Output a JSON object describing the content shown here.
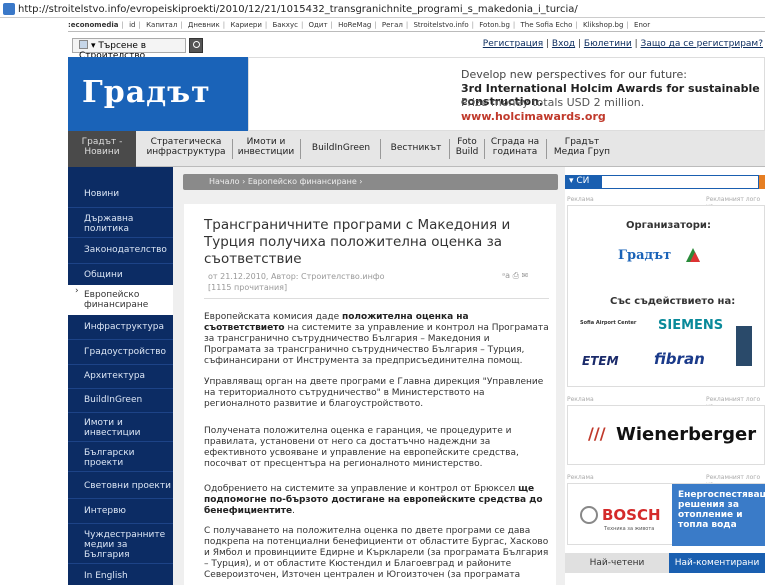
{
  "browser": {
    "url": "http://stroitelstvo.info/evropeiskiproekti/2010/12/21/1015432_transgranichnite_programi_s_makedonia_i_turcia/"
  },
  "topnav": [
    ":economedia",
    "id",
    "Капитал",
    "Дневник",
    "Кариери",
    "Бакхус",
    "Одит",
    "HoReMag",
    "Регал",
    "Stroitelstvo.info",
    "Foton.bg",
    "The Sofia Echo",
    "Klikshop.bg",
    "Enor"
  ],
  "search": {
    "label": "Търсене в Строителство"
  },
  "userlinks": [
    "Регистрация",
    "Вход",
    "Бюлетини",
    "Защо да се регистрирам?"
  ],
  "logo": "Градът",
  "ad": {
    "line1": "Develop new perspectives for our future:",
    "line2": "3rd International Holcim Awards for sustainable construction.",
    "line3": "Prize money totals USD 2 million.",
    "line4": "www.holcimawards.org"
  },
  "mainnav": [
    {
      "l1": "Градът -",
      "l2": "Новини"
    },
    {
      "l1": "Стратегическа",
      "l2": "инфраструктура"
    },
    {
      "l1": "Имоти и",
      "l2": "инвестиции"
    },
    {
      "l1": "BuildInGreen",
      "l2": ""
    },
    {
      "l1": "Вестникът",
      "l2": ""
    },
    {
      "l1": "Foto",
      "l2": "Build"
    },
    {
      "l1": "Сграда на",
      "l2": "годината"
    },
    {
      "l1": "Градът",
      "l2": "Медиа Груп"
    }
  ],
  "leftnav": [
    {
      "l1": "Новини",
      "l2": ""
    },
    {
      "l1": "Държавна",
      "l2": "политика"
    },
    {
      "l1": "Законодателство",
      "l2": ""
    },
    {
      "l1": "Общини",
      "l2": ""
    },
    {
      "l1": "Европейско",
      "l2": "финансиране"
    },
    {
      "l1": "Инфраструктура",
      "l2": ""
    },
    {
      "l1": "Градоустройство",
      "l2": ""
    },
    {
      "l1": "Архитектура",
      "l2": ""
    },
    {
      "l1": "BuildInGreen",
      "l2": ""
    },
    {
      "l1": "Имоти и",
      "l2": "инвестиции"
    },
    {
      "l1": "Български",
      "l2": "проекти"
    },
    {
      "l1": "Световни проекти",
      "l2": ""
    },
    {
      "l1": "Интервю",
      "l2": ""
    },
    {
      "l1": "Чуждестранните",
      "l2": "медии за"
    },
    {
      "l1": "In English",
      "l2": ""
    }
  ],
  "leftnav_extra": "България",
  "breadcrumb": "Начало › Европейско финансиране ›",
  "article": {
    "title": "Трансграничните програми с Македония и Турция получиха положителна оценка за съответствие",
    "meta": "от 21.12.2010, Автор: Строителство.инфо",
    "reads": "[1115 прочитания]",
    "p1a": "Европейската комисия даде ",
    "p1b": "положителна оценка на съответствието",
    "p1c": " на системите за управление и контрол на Програмата за трансгранично сътрудничество България – Македония и Програмата за трансгранично сътрудничество България – Турция, съфинансирани от Инструмента за предприсъединителна помощ.",
    "p2": "Управляващ орган на двете програми е Главна дирекция \"Управление на териториалното сътрудничество\" в Министерството на регионалното развитие и благоустройството.",
    "p3": "Получената положителна оценка е гаранция, че процедурите и правилата, установени от него са достатъчно надеждни за ефективното усвояване и управление на европейските средства, посочват от пресцентъра на регионалното министерство.",
    "p4a": "Одобрението на системите за управление и контрол от Брюксел ",
    "p4b": "ще подпомогне по-бързото достигане на европейските средства до бенефициентите",
    "p4c": ".",
    "p5": "С получаването на положителна оценка по двете програми се дава подкрепа на потенциални бенефициенти от областите Бургас, Хасково и Ямбол и провинциите Едирне и Къркларели (за програмата България – Турция), и от областите Кюстендил и Благоевград и районите Североизточен, Източен централен и Югоизточен (за програмата"
  },
  "sidebar": {
    "search_select": "СИ",
    "reklama": "Реклама",
    "reklama_right": "Рекламният лого на",
    "organizers": "Организатори:",
    "cooperation": "Със съдействието на:",
    "logos": [
      "Градът",
      "Sofia Airport Center",
      "SIEMENS",
      "ЕТЕМ",
      "fibran"
    ],
    "wienerberger": "Wienerberger",
    "bosch": "BOSCH",
    "bosch_sub": "Техника за живота",
    "bosch_ad": "Енергоспестяващи решения за отопление и топла вода",
    "tab1": "Най-четени",
    "tab2": "Най-коментирани"
  }
}
